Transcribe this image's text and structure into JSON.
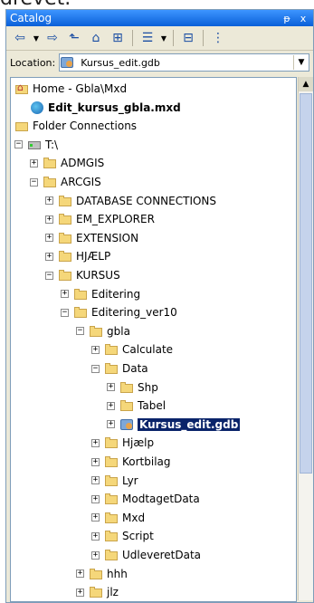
{
  "caption": "drevet.",
  "window": {
    "title": "Catalog",
    "pin": "ᵽ",
    "close": "x"
  },
  "toolbar": {
    "back": "⇦",
    "dropdown": "▼",
    "forward": "⇨",
    "up": "⬑",
    "home": "⌂",
    "connect": "⊞",
    "views": "☰",
    "views_drop": "▼",
    "options": "⊟",
    "tree": "⋮"
  },
  "location": {
    "label": "Location:",
    "value": "Kursus_edit.gdb",
    "drop": "▼"
  },
  "tree": [
    {
      "label": "Home - Gbla\\Mxd",
      "icon": "home",
      "level": 0,
      "exp": ""
    },
    {
      "label": "Edit_kursus_gbla.mxd",
      "icon": "mxd",
      "level": 1,
      "exp": "",
      "bold": true
    },
    {
      "label": "Folder Connections",
      "icon": "conn",
      "level": 0,
      "exp": ""
    },
    {
      "label": "T:\\",
      "icon": "drive",
      "level": 0,
      "exp": "−"
    },
    {
      "label": "ADMGIS",
      "icon": "folder",
      "level": 1,
      "exp": "+"
    },
    {
      "label": "ARCGIS",
      "icon": "folder",
      "level": 1,
      "exp": "−"
    },
    {
      "label": "DATABASE CONNECTIONS",
      "icon": "folder",
      "level": 2,
      "exp": "+"
    },
    {
      "label": "EM_EXPLORER",
      "icon": "folder",
      "level": 2,
      "exp": "+"
    },
    {
      "label": "EXTENSION",
      "icon": "folder",
      "level": 2,
      "exp": "+"
    },
    {
      "label": "HJÆLP",
      "icon": "folder",
      "level": 2,
      "exp": "+"
    },
    {
      "label": "KURSUS",
      "icon": "folder",
      "level": 2,
      "exp": "−"
    },
    {
      "label": "Editering",
      "icon": "folder",
      "level": 3,
      "exp": "+"
    },
    {
      "label": "Editering_ver10",
      "icon": "folder",
      "level": 3,
      "exp": "−"
    },
    {
      "label": "gbla",
      "icon": "folder",
      "level": 4,
      "exp": "−"
    },
    {
      "label": "Calculate",
      "icon": "folder",
      "level": 5,
      "exp": "+"
    },
    {
      "label": "Data",
      "icon": "folder",
      "level": 5,
      "exp": "−"
    },
    {
      "label": "Shp",
      "icon": "folder",
      "level": 6,
      "exp": "+"
    },
    {
      "label": "Tabel",
      "icon": "folder",
      "level": 6,
      "exp": "+"
    },
    {
      "label": "Kursus_edit.gdb",
      "icon": "gdb",
      "level": 6,
      "exp": "+",
      "selected": true
    },
    {
      "label": "Hjælp",
      "icon": "folder",
      "level": 5,
      "exp": "+"
    },
    {
      "label": "Kortbilag",
      "icon": "folder",
      "level": 5,
      "exp": "+"
    },
    {
      "label": "Lyr",
      "icon": "folder",
      "level": 5,
      "exp": "+"
    },
    {
      "label": "ModtagetData",
      "icon": "folder",
      "level": 5,
      "exp": "+"
    },
    {
      "label": "Mxd",
      "icon": "folder",
      "level": 5,
      "exp": "+"
    },
    {
      "label": "Script",
      "icon": "folder",
      "level": 5,
      "exp": "+"
    },
    {
      "label": "UdleveretData",
      "icon": "folder",
      "level": 5,
      "exp": "+"
    },
    {
      "label": "hhh",
      "icon": "folder",
      "level": 4,
      "exp": "+"
    },
    {
      "label": "jlz",
      "icon": "folder",
      "level": 4,
      "exp": "+"
    }
  ],
  "scrollbar": {
    "up": "▲"
  }
}
